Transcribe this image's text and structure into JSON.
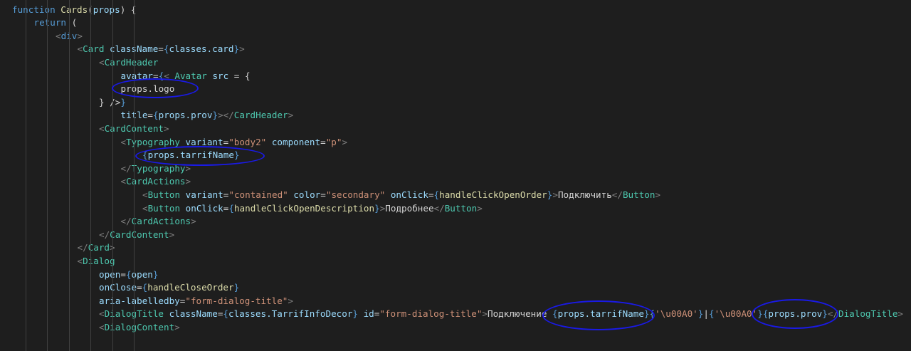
{
  "lines": [
    {
      "indent": 0,
      "tokens": [
        {
          "t": "function ",
          "c": "kw"
        },
        {
          "t": "Cards",
          "c": "fn"
        },
        {
          "t": "(",
          "c": "plain"
        },
        {
          "t": "props",
          "c": "var"
        },
        {
          "t": ") {",
          "c": "plain"
        }
      ]
    },
    {
      "indent": 1,
      "tokens": [
        {
          "t": "return",
          "c": "kw"
        },
        {
          "t": " (",
          "c": "plain"
        }
      ]
    },
    {
      "indent": 2,
      "tokens": [
        {
          "t": "<",
          "c": "punc"
        },
        {
          "t": "div",
          "c": "kw"
        },
        {
          "t": ">",
          "c": "punc"
        }
      ]
    },
    {
      "indent": 3,
      "tokens": [
        {
          "t": "<",
          "c": "punc"
        },
        {
          "t": "Card",
          "c": "tag"
        },
        {
          "t": " ",
          "c": "plain"
        },
        {
          "t": "className",
          "c": "attr"
        },
        {
          "t": "=",
          "c": "plain"
        },
        {
          "t": "{",
          "c": "brace"
        },
        {
          "t": "classes.card",
          "c": "var"
        },
        {
          "t": "}",
          "c": "brace"
        },
        {
          "t": ">",
          "c": "punc"
        }
      ]
    },
    {
      "indent": 4,
      "tokens": [
        {
          "t": "<",
          "c": "punc"
        },
        {
          "t": "CardHeader",
          "c": "tag"
        }
      ]
    },
    {
      "indent": 5,
      "tokens": [
        {
          "t": "avatar",
          "c": "attr"
        },
        {
          "t": "=",
          "c": "plain"
        },
        {
          "t": "{",
          "c": "brace"
        },
        {
          "t": "< ",
          "c": "punc"
        },
        {
          "t": "Avatar",
          "c": "tag"
        },
        {
          "t": " src",
          "c": "attr"
        },
        {
          "t": " = {",
          "c": "plain"
        }
      ]
    },
    {
      "indent": 5,
      "tokens": [
        {
          "t": "props.logo",
          "c": "plain"
        }
      ]
    },
    {
      "indent": 4,
      "tokens": [
        {
          "t": "} />",
          "c": "plain"
        },
        {
          "t": "}",
          "c": "brace"
        }
      ]
    },
    {
      "indent": 5,
      "tokens": [
        {
          "t": "title",
          "c": "attr"
        },
        {
          "t": "=",
          "c": "plain"
        },
        {
          "t": "{",
          "c": "brace"
        },
        {
          "t": "props.prov",
          "c": "var"
        },
        {
          "t": "}",
          "c": "brace"
        },
        {
          "t": "></",
          "c": "punc"
        },
        {
          "t": "CardHeader",
          "c": "tag"
        },
        {
          "t": ">",
          "c": "punc"
        }
      ]
    },
    {
      "indent": 4,
      "tokens": [
        {
          "t": "<",
          "c": "punc"
        },
        {
          "t": "CardContent",
          "c": "tag"
        },
        {
          "t": ">",
          "c": "punc"
        }
      ]
    },
    {
      "indent": 5,
      "tokens": [
        {
          "t": "<",
          "c": "punc"
        },
        {
          "t": "Typography",
          "c": "tag"
        },
        {
          "t": " variant",
          "c": "attr"
        },
        {
          "t": "=",
          "c": "plain"
        },
        {
          "t": "\"body2\"",
          "c": "str"
        },
        {
          "t": " component",
          "c": "attr"
        },
        {
          "t": "=",
          "c": "plain"
        },
        {
          "t": "\"p\"",
          "c": "str"
        },
        {
          "t": ">",
          "c": "punc"
        }
      ]
    },
    {
      "indent": 6,
      "tokens": [
        {
          "t": "{",
          "c": "brace"
        },
        {
          "t": "props.tarrifName",
          "c": "var"
        },
        {
          "t": "}",
          "c": "brace"
        }
      ]
    },
    {
      "indent": 5,
      "tokens": [
        {
          "t": "</",
          "c": "punc"
        },
        {
          "t": "Typography",
          "c": "tag"
        },
        {
          "t": ">",
          "c": "punc"
        }
      ]
    },
    {
      "indent": 5,
      "tokens": [
        {
          "t": "<",
          "c": "punc"
        },
        {
          "t": "CardActions",
          "c": "tag"
        },
        {
          "t": ">",
          "c": "punc"
        }
      ]
    },
    {
      "indent": 6,
      "tokens": [
        {
          "t": "<",
          "c": "punc"
        },
        {
          "t": "Button",
          "c": "tag"
        },
        {
          "t": " variant",
          "c": "attr"
        },
        {
          "t": "=",
          "c": "plain"
        },
        {
          "t": "\"contained\"",
          "c": "str"
        },
        {
          "t": " color",
          "c": "attr"
        },
        {
          "t": "=",
          "c": "plain"
        },
        {
          "t": "\"secondary\"",
          "c": "str"
        },
        {
          "t": " onClick",
          "c": "attr"
        },
        {
          "t": "=",
          "c": "plain"
        },
        {
          "t": "{",
          "c": "brace"
        },
        {
          "t": "handleClickOpenOrder",
          "c": "fn"
        },
        {
          "t": "}",
          "c": "brace"
        },
        {
          "t": ">",
          "c": "punc"
        },
        {
          "t": "Подключить",
          "c": "plain"
        },
        {
          "t": "</",
          "c": "punc"
        },
        {
          "t": "Button",
          "c": "tag"
        },
        {
          "t": ">",
          "c": "punc"
        }
      ]
    },
    {
      "indent": 6,
      "tokens": [
        {
          "t": "<",
          "c": "punc"
        },
        {
          "t": "Button",
          "c": "tag"
        },
        {
          "t": " onClick",
          "c": "attr"
        },
        {
          "t": "=",
          "c": "plain"
        },
        {
          "t": "{",
          "c": "brace"
        },
        {
          "t": "handleClickOpenDescription",
          "c": "fn"
        },
        {
          "t": "}",
          "c": "brace"
        },
        {
          "t": ">",
          "c": "punc"
        },
        {
          "t": "Подробнее",
          "c": "plain"
        },
        {
          "t": "</",
          "c": "punc"
        },
        {
          "t": "Button",
          "c": "tag"
        },
        {
          "t": ">",
          "c": "punc"
        }
      ]
    },
    {
      "indent": 5,
      "tokens": [
        {
          "t": "</",
          "c": "punc"
        },
        {
          "t": "CardActions",
          "c": "tag"
        },
        {
          "t": ">",
          "c": "punc"
        }
      ]
    },
    {
      "indent": 4,
      "tokens": [
        {
          "t": "</",
          "c": "punc"
        },
        {
          "t": "CardContent",
          "c": "tag"
        },
        {
          "t": ">",
          "c": "punc"
        }
      ]
    },
    {
      "indent": 3,
      "tokens": [
        {
          "t": "</",
          "c": "punc"
        },
        {
          "t": "Card",
          "c": "tag"
        },
        {
          "t": ">",
          "c": "punc"
        }
      ]
    },
    {
      "indent": 3,
      "tokens": [
        {
          "t": "<",
          "c": "punc"
        },
        {
          "t": "Dialog",
          "c": "tag"
        }
      ]
    },
    {
      "indent": 4,
      "tokens": [
        {
          "t": "open",
          "c": "attr"
        },
        {
          "t": "=",
          "c": "plain"
        },
        {
          "t": "{",
          "c": "brace"
        },
        {
          "t": "open",
          "c": "var"
        },
        {
          "t": "}",
          "c": "brace"
        }
      ]
    },
    {
      "indent": 4,
      "tokens": [
        {
          "t": "onClose",
          "c": "attr"
        },
        {
          "t": "=",
          "c": "plain"
        },
        {
          "t": "{",
          "c": "brace"
        },
        {
          "t": "handleCloseOrder",
          "c": "fn"
        },
        {
          "t": "}",
          "c": "brace"
        }
      ]
    },
    {
      "indent": 4,
      "tokens": [
        {
          "t": "aria-labelledby",
          "c": "attr"
        },
        {
          "t": "=",
          "c": "plain"
        },
        {
          "t": "\"form-dialog-title\"",
          "c": "str"
        },
        {
          "t": ">",
          "c": "punc"
        }
      ]
    },
    {
      "indent": 4,
      "tokens": [
        {
          "t": "<",
          "c": "punc"
        },
        {
          "t": "DialogTitle",
          "c": "tag"
        },
        {
          "t": " className",
          "c": "attr"
        },
        {
          "t": "=",
          "c": "plain"
        },
        {
          "t": "{",
          "c": "brace"
        },
        {
          "t": "classes.TarrifInfoDecor",
          "c": "var"
        },
        {
          "t": "}",
          "c": "brace"
        },
        {
          "t": " id",
          "c": "attr"
        },
        {
          "t": "=",
          "c": "plain"
        },
        {
          "t": "\"form-dialog-title\"",
          "c": "str"
        },
        {
          "t": ">",
          "c": "punc"
        },
        {
          "t": "Подключение ",
          "c": "plain"
        },
        {
          "t": "{",
          "c": "brace"
        },
        {
          "t": "props.tarrifName",
          "c": "var"
        },
        {
          "t": "}",
          "c": "brace"
        },
        {
          "t": "{",
          "c": "brace"
        },
        {
          "t": "'\\u00A0'",
          "c": "str"
        },
        {
          "t": "}",
          "c": "brace"
        },
        {
          "t": "|",
          "c": "plain"
        },
        {
          "t": "{",
          "c": "brace"
        },
        {
          "t": "'\\u00A0'",
          "c": "str"
        },
        {
          "t": "}",
          "c": "brace"
        },
        {
          "t": "{",
          "c": "brace"
        },
        {
          "t": "props.prov",
          "c": "var"
        },
        {
          "t": "}",
          "c": "brace"
        },
        {
          "t": "</",
          "c": "punc"
        },
        {
          "t": "DialogTitle",
          "c": "tag"
        },
        {
          "t": ">",
          "c": "punc"
        }
      ]
    },
    {
      "indent": 4,
      "tokens": [
        {
          "t": "<",
          "c": "punc"
        },
        {
          "t": "DialogContent",
          "c": "tag"
        },
        {
          "t": ">",
          "c": "punc"
        }
      ]
    },
    {
      "indent": 5,
      "tokens": []
    }
  ],
  "colors": {
    "background": "#1e1e1e",
    "keyword": "#569cd6",
    "function": "#dcdcaa",
    "tag": "#4ec9b0",
    "punctuation": "#808080",
    "attribute": "#9cdcfe",
    "string": "#ce9178",
    "text": "#d4d4d4",
    "annotation": "#1a1ae6"
  }
}
